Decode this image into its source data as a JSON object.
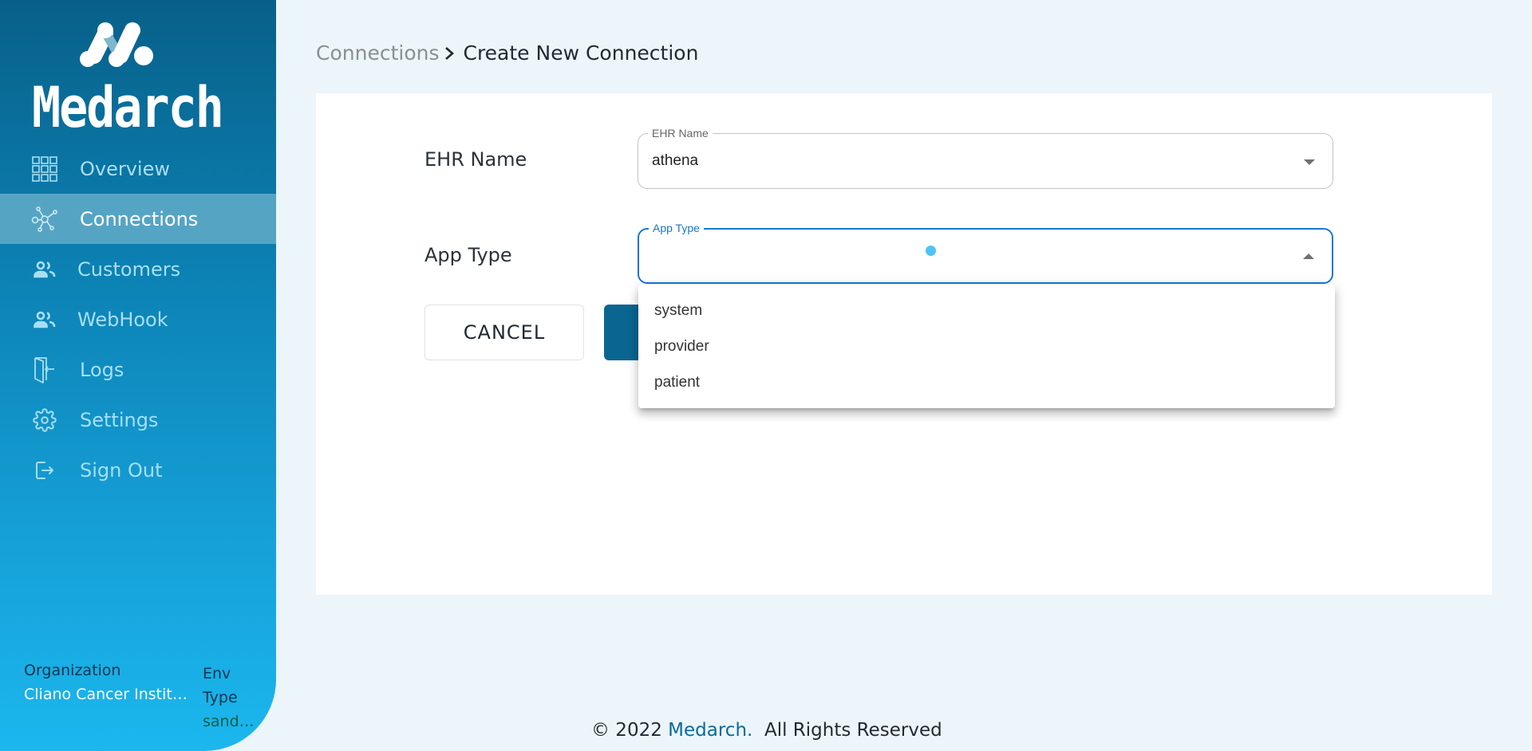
{
  "brand": {
    "name": "Medarch"
  },
  "sidebar": {
    "items": [
      {
        "label": "Overview",
        "icon": "grid-icon",
        "active": false
      },
      {
        "label": "Connections",
        "icon": "network-icon",
        "active": true
      },
      {
        "label": "Customers",
        "icon": "people-icon",
        "active": false
      },
      {
        "label": "WebHook",
        "icon": "people-icon",
        "active": false
      },
      {
        "label": "Logs",
        "icon": "door-enter-icon",
        "active": false
      },
      {
        "label": "Settings",
        "icon": "gear-icon",
        "active": false
      },
      {
        "label": "Sign Out",
        "icon": "sign-out-icon",
        "active": false
      }
    ],
    "organization": {
      "label": "Organization",
      "value": "Cliano Cancer Institute"
    },
    "env": {
      "label_line1": "Env",
      "label_line2": "Type",
      "value": "sandbox"
    }
  },
  "breadcrumb": {
    "parent": "Connections",
    "current": "Create New Connection"
  },
  "form": {
    "ehr_name": {
      "label": "EHR Name",
      "legend": "EHR Name",
      "value": "athena"
    },
    "app_type": {
      "label": "App Type",
      "legend": "App Type",
      "value": "",
      "options": [
        "system",
        "provider",
        "patient"
      ]
    },
    "cancel_label": "CANCEL",
    "submit_label": ""
  },
  "footer": {
    "prefix": "© 2022 ",
    "brand": "Medarch.",
    "suffix": "  All Rights Reserved"
  },
  "colors": {
    "accent": "#0a6690",
    "focus": "#1976d2",
    "active_nav": "#56a4c4",
    "background": "#ecf5f9"
  }
}
